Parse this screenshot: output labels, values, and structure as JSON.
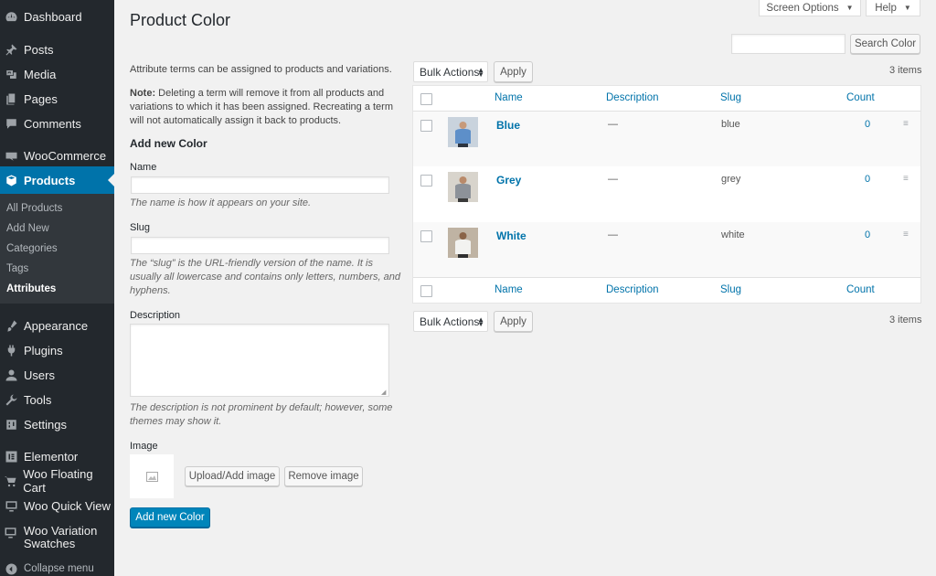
{
  "sidebar": {
    "dashboard": "Dashboard",
    "posts": "Posts",
    "media": "Media",
    "pages": "Pages",
    "comments": "Comments",
    "woocommerce": "WooCommerce",
    "products": "Products",
    "submenu": [
      "All Products",
      "Add New",
      "Categories",
      "Tags",
      "Attributes"
    ],
    "appearance": "Appearance",
    "plugins": "Plugins",
    "users": "Users",
    "tools": "Tools",
    "settings": "Settings",
    "elementor": "Elementor",
    "woo_floating_cart": "Woo Floating Cart",
    "woo_quick_view": "Woo Quick View",
    "woo_variation_swatches": "Woo Variation Swatches",
    "collapse": "Collapse menu"
  },
  "header": {
    "title": "Product Color",
    "screen_options": "Screen Options",
    "help": "Help",
    "search_button": "Search Color",
    "search_value": ""
  },
  "form": {
    "intro": "Attribute terms can be assigned to products and variations.",
    "note_label": "Note:",
    "note_text": " Deleting a term will remove it from all products and variations to which it has been assigned. Recreating a term will not automatically assign it back to products.",
    "add_heading": "Add new Color",
    "name_label": "Name",
    "name_value": "",
    "name_desc": "The name is how it appears on your site.",
    "slug_label": "Slug",
    "slug_value": "",
    "slug_desc": "The “slug” is the URL-friendly version of the name. It is usually all lowercase and contains only letters, numbers, and hyphens.",
    "description_label": "Description",
    "description_value": "",
    "description_desc": "The description is not prominent by default; however, some themes may show it.",
    "image_label": "Image",
    "upload_button": "Upload/Add image",
    "remove_button": "Remove image",
    "submit_button": "Add new Color"
  },
  "table": {
    "bulk_actions": "Bulk Actions",
    "apply": "Apply",
    "items_count": "3 items",
    "columns": [
      "Name",
      "Description",
      "Slug",
      "Count"
    ],
    "rows": [
      {
        "name": "Blue",
        "description": "—",
        "slug": "blue",
        "count": "0",
        "shirt_color": "#5d8fc9"
      },
      {
        "name": "Grey",
        "description": "—",
        "slug": "grey",
        "count": "0",
        "shirt_color": "#8d9299"
      },
      {
        "name": "White",
        "description": "—",
        "slug": "white",
        "count": "0",
        "shirt_color": "#f2f2f0"
      }
    ]
  },
  "colors": {
    "sidebar_bg": "#23282d",
    "active": "#0073aa",
    "link": "#0073aa",
    "primary_button": "#0085ba"
  }
}
